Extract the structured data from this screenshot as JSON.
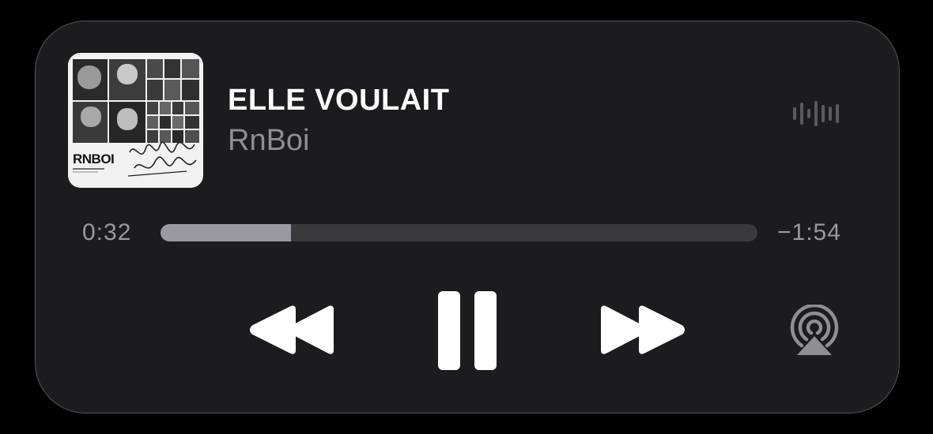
{
  "now_playing": {
    "title": "ELLE VOULAIT",
    "artist": "RnBoi",
    "artwork": {
      "brand_text": "RNBOI"
    }
  },
  "progress": {
    "elapsed": "0:32",
    "remaining": "−1:54",
    "fraction": 0.218
  },
  "controls": {
    "rewind_icon": "backward-icon",
    "pause_icon": "pause-icon",
    "forward_icon": "forward-icon",
    "airplay_icon": "airplay-audio-icon",
    "waveform_icon": "waveform-icon"
  },
  "colors": {
    "card_background": "#1c1c1e",
    "progress_fill": "#9a99a1",
    "progress_track": "#3a3a3c",
    "secondary_text": "#8e8e93"
  }
}
